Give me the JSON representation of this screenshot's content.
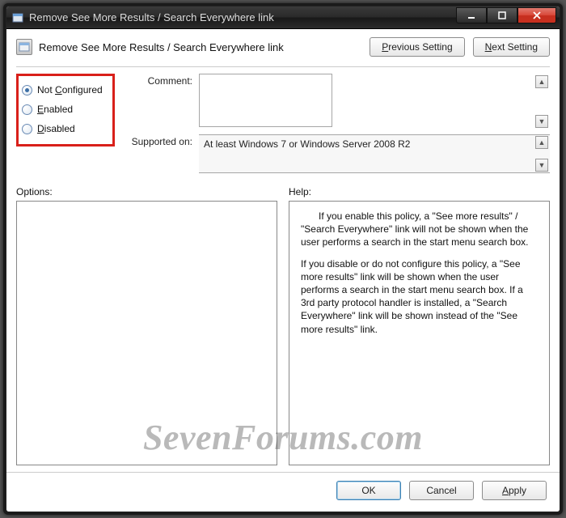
{
  "window": {
    "title": "Remove See More Results / Search Everywhere link"
  },
  "header": {
    "title": "Remove See More Results / Search Everywhere link",
    "prev_button": "Previous Setting",
    "next_button": "Next Setting",
    "prev_accel": "P",
    "next_accel": "N"
  },
  "state": {
    "options": [
      {
        "label": "Not Configured",
        "accel": "C",
        "checked": true
      },
      {
        "label": "Enabled",
        "accel": "E",
        "checked": false
      },
      {
        "label": "Disabled",
        "accel": "D",
        "checked": false
      }
    ]
  },
  "fields": {
    "comment_label": "Comment:",
    "comment_value": "",
    "supported_label": "Supported on:",
    "supported_value": "At least Windows 7 or Windows Server 2008 R2"
  },
  "panels": {
    "options_label": "Options:",
    "help_label": "Help:",
    "help_paragraphs": [
      "If you enable this policy, a \"See more results\" / \"Search Everywhere\" link will not be shown when the user performs a search in the start menu search box.",
      "If you disable or do not configure this policy, a \"See more results\" link will be shown when the user performs a search in the start menu search box.  If a 3rd party protocol handler is installed, a \"Search Everywhere\" link will be shown instead of the \"See more results\" link."
    ]
  },
  "footer": {
    "ok": "OK",
    "cancel": "Cancel",
    "apply": "Apply",
    "apply_accel": "A"
  },
  "watermark": "SevenForums.com"
}
